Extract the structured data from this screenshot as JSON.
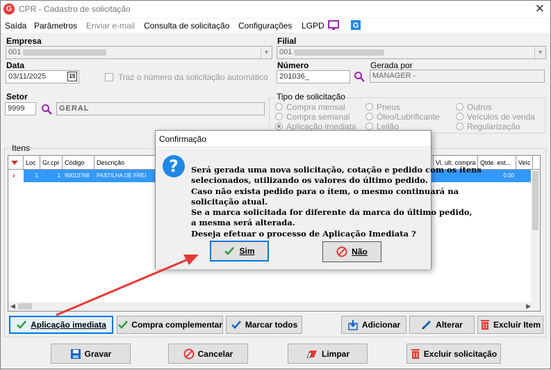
{
  "window": {
    "title": "CPR - Cadastro de solicitação",
    "close_glyph": "✕"
  },
  "menu": {
    "items": [
      {
        "label": "Saída"
      },
      {
        "label": "Parâmetros"
      },
      {
        "label": "Enviar e-mail",
        "disabled": true
      },
      {
        "label": "Consulta de solicitação"
      },
      {
        "label": "Configurações"
      },
      {
        "label": "LGPD"
      }
    ]
  },
  "form": {
    "empresa_label": "Empresa",
    "empresa_value": "001",
    "filial_label": "Filial",
    "filial_value": "001",
    "data_label": "Data",
    "data_value": "03/11/2025",
    "calendar_glyph": "15",
    "auto_number_label": "Traz o número da solicitação automático",
    "numero_label": "Número",
    "numero_value": "201036_",
    "gerada_por_label": "Gerada por",
    "gerada_por_value": "MANAGER -",
    "setor_label": "Setor",
    "setor_code": "9999",
    "setor_name": "GERAL"
  },
  "tipo_solicitacao": {
    "label": "Tipo de solicitação",
    "options": [
      {
        "label": "Compra mensal",
        "selected": false
      },
      {
        "label": "Compra semanal",
        "selected": false
      },
      {
        "label": "Aplicação imediata",
        "selected": true
      },
      {
        "label": "Pneus",
        "selected": false
      },
      {
        "label": "Óleo/Lubrificante",
        "selected": false
      },
      {
        "label": "Leilão",
        "selected": false
      },
      {
        "label": "Outros",
        "selected": false
      },
      {
        "label": "Veículos de venda",
        "selected": false
      },
      {
        "label": "Regularização",
        "selected": false
      }
    ]
  },
  "itens": {
    "label": "Itens",
    "columns": [
      "Loc",
      "Gr.cpr",
      "Código",
      "Descrição",
      "Vl. ult. compra",
      "Qtde. est...",
      "Veíc"
    ],
    "rows": [
      {
        "loc": "1",
        "grcpr": "1",
        "codigo": "90013768",
        "descricao": "PASTILHA DE FREI",
        "qtde": "0,00"
      }
    ]
  },
  "item_buttons": {
    "aplicacao_imediata": "Aplicação imediata",
    "compra_complementar": "Compra complementar",
    "marcar_todos": "Marcar todos",
    "adicionar": "Adicionar",
    "alterar": "Alterar",
    "excluir_item": "Excluir Item"
  },
  "footer_buttons": {
    "gravar": "Gravar",
    "cancelar": "Cancelar",
    "limpar": "Limpar",
    "excluir_solicitacao": "Excluir solicitação"
  },
  "dialog": {
    "title": "Confirmação",
    "icon": "?",
    "lines": [
      "Será gerada uma nova solicitação, cotação e pedido com os ítens",
      "selecionados, utilizando os valores do último pedido.",
      "Caso não exista pedido para o ítem, o mesmo continuará na",
      "solicitação atual.",
      "Se a marca solicitada for diferente da marca do último pedido,",
      "a mesma será alterada.",
      "Deseja efetuar o processo de Aplicação Imediata ?"
    ],
    "yes_label": "Sim",
    "no_label": "Não"
  },
  "colors": {
    "selection": "#3399ff",
    "focus": "#0078d7",
    "danger": "#e53935",
    "accent_purple": "#9c27b0"
  }
}
